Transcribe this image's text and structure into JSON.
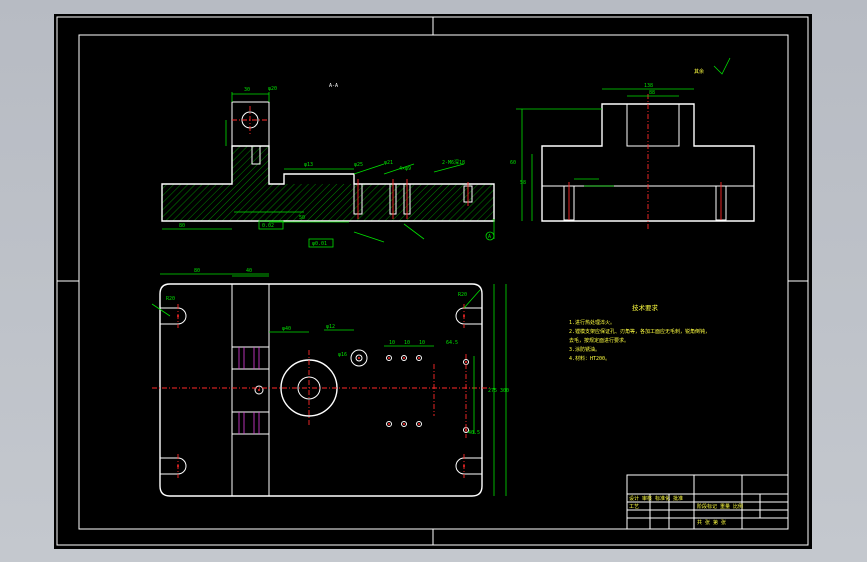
{
  "drawing": {
    "section_label": "A-A",
    "roughness_note": "其余",
    "tech_req": {
      "title": "技术要求",
      "items": [
        "1.进行热处理淬火。",
        "2.镗模支架应保证孔、刃角等，各加工面应无毛刺，锐角倒钝，",
        "  去毛，按规定面进行要求。",
        "3.涂防锈油。",
        "4.材料：HT200。"
      ]
    },
    "dims_section": [
      "30",
      "φ20",
      "φ13",
      "φ25",
      "φ21",
      "4×φ9",
      "2-M6深18",
      "0.02",
      "80",
      "50",
      "φ0.01",
      "A"
    ],
    "dims_side": [
      "138",
      "88",
      "60",
      "58"
    ],
    "dims_plan": [
      "80",
      "40",
      "R20",
      "φ40",
      "φ12",
      "φ16",
      "10",
      "10",
      "10",
      "64.5",
      "R20",
      "275",
      "300",
      "40.5"
    ],
    "title_block": {
      "rows": [
        "设计 审核 标准化 批准",
        "工艺",
        "阶段标记 重量 比例",
        "共 张 第 张"
      ]
    }
  }
}
